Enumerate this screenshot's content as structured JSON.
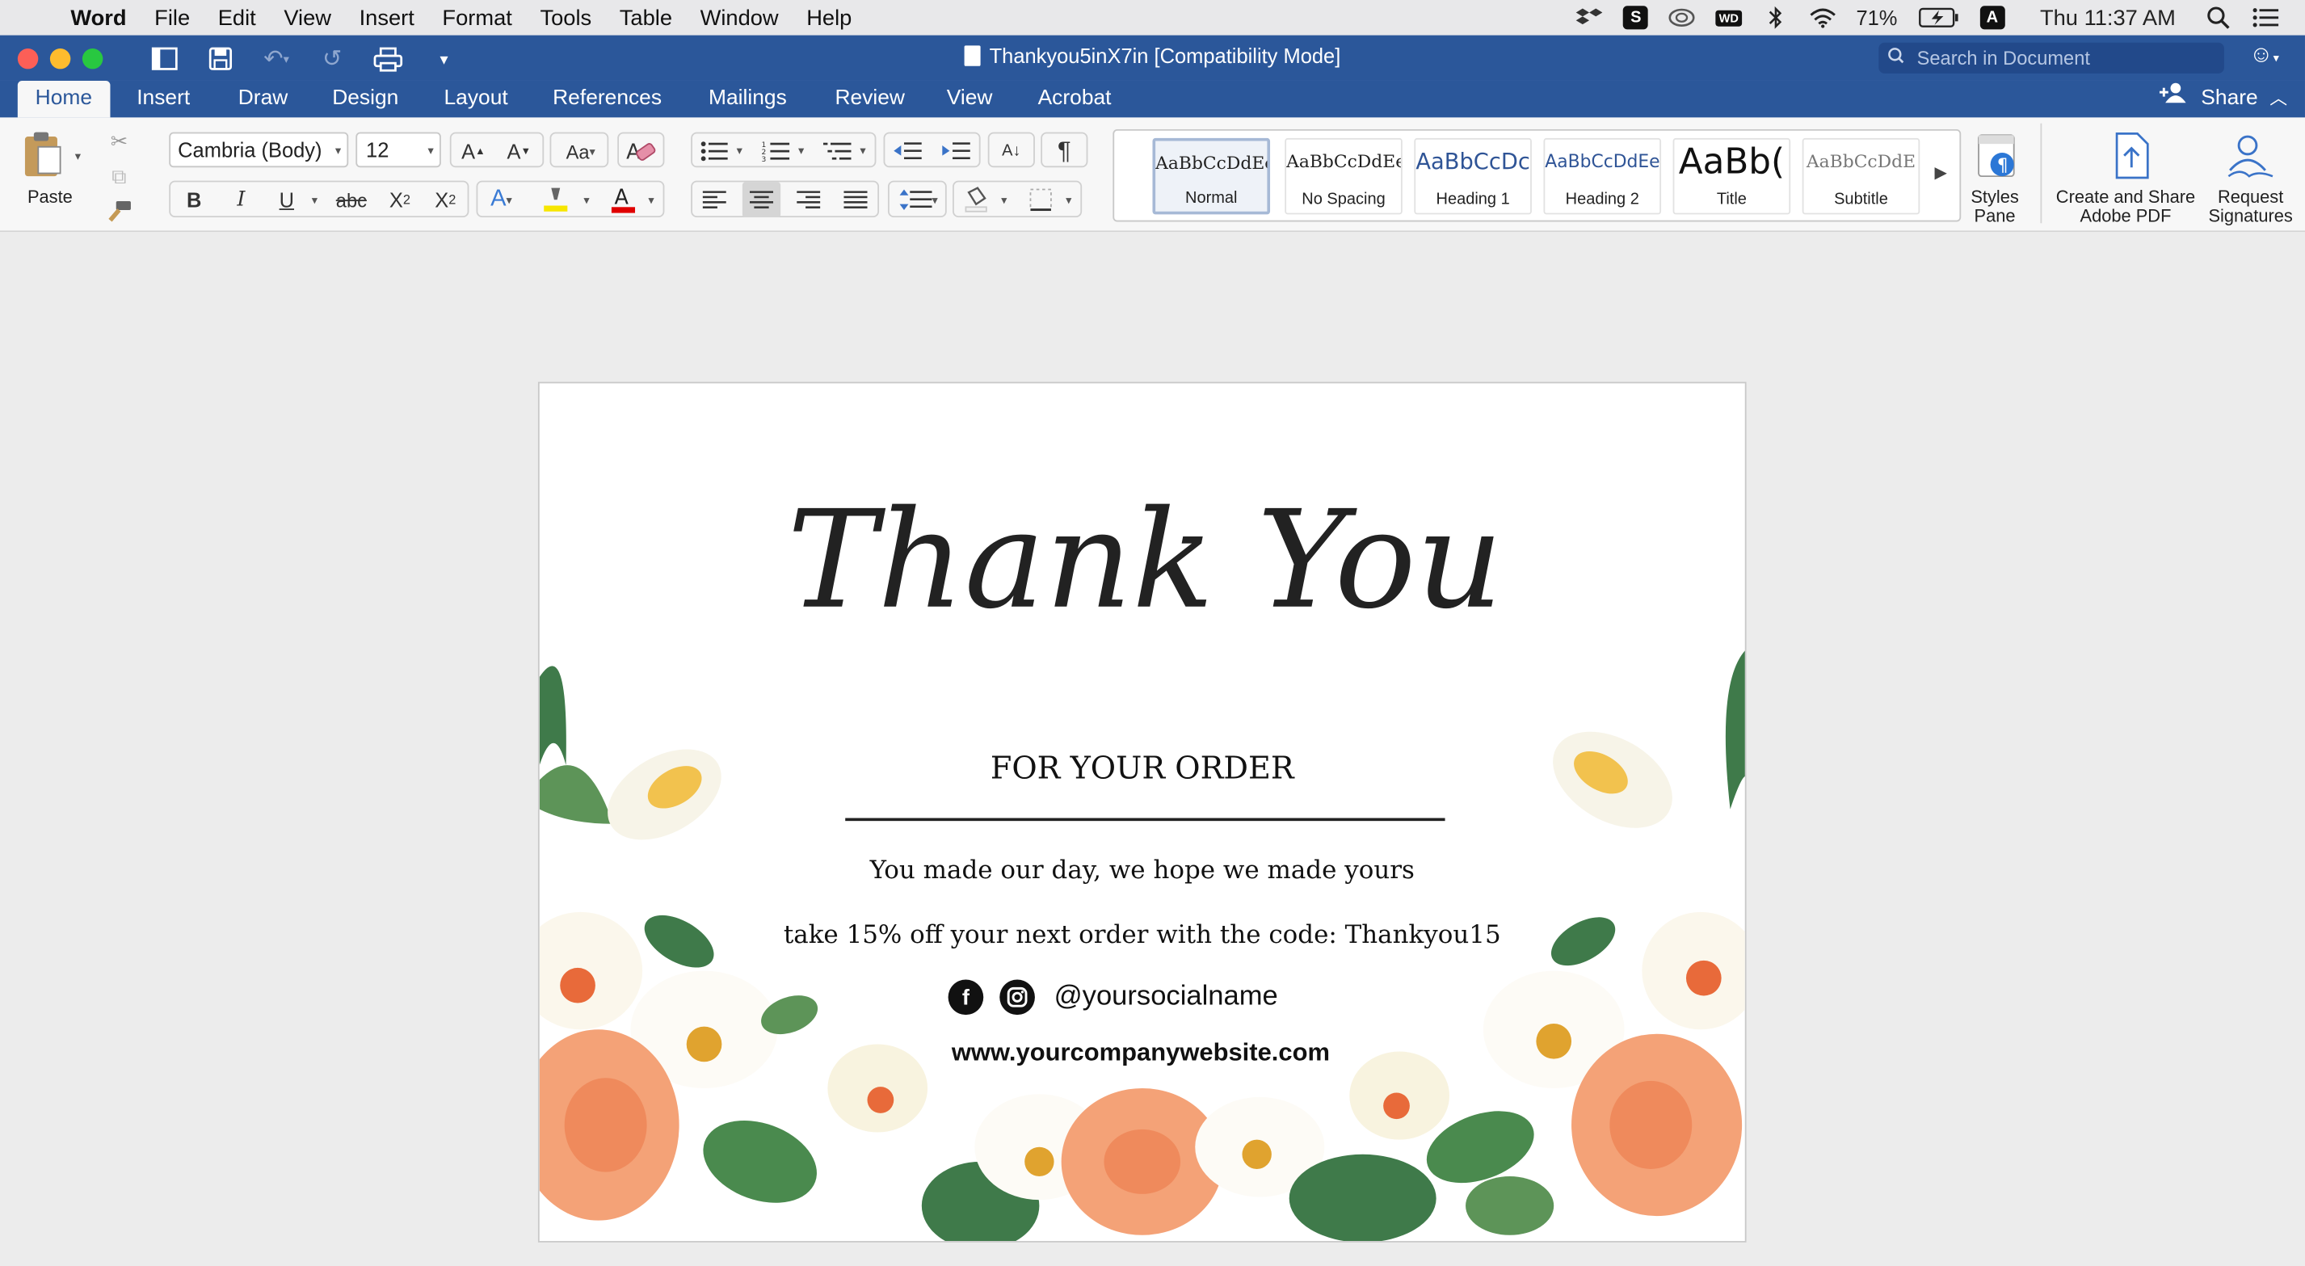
{
  "menubar": {
    "app": "Word",
    "items": [
      "File",
      "Edit",
      "View",
      "Insert",
      "Format",
      "Tools",
      "Table",
      "Window",
      "Help"
    ],
    "battery": "71%",
    "input_source": "A",
    "clock": "Thu 11:37 AM"
  },
  "window": {
    "title": "Thankyou5inX7in [Compatibility Mode]",
    "search_placeholder": "Search in Document"
  },
  "ribbon_tabs": [
    "Home",
    "Insert",
    "Draw",
    "Design",
    "Layout",
    "References",
    "Mailings",
    "Review",
    "View",
    "Acrobat"
  ],
  "active_tab": "Home",
  "share_label": "Share",
  "ribbon": {
    "paste_label": "Paste",
    "font_name": "Cambria (Body)",
    "font_size": "12",
    "styles": [
      {
        "preview": "AaBbCcDdEe",
        "name": "Normal"
      },
      {
        "preview": "AaBbCcDdEe",
        "name": "No Spacing"
      },
      {
        "preview": "AaBbCcDc",
        "name": "Heading 1"
      },
      {
        "preview": "AaBbCcDdEe",
        "name": "Heading 2"
      },
      {
        "preview": "AaBb(",
        "name": "Title"
      },
      {
        "preview": "AaBbCcDdE",
        "name": "Subtitle"
      }
    ],
    "styles_pane_label": "Styles Pane",
    "create_share_pdf_label": "Create and Share Adobe PDF",
    "request_signatures_label": "Request Signatures"
  },
  "colors": {
    "word_blue": "#2b579a",
    "highlight_yellow": "#f7e600",
    "font_red": "#e00000",
    "flower_peach": "#f4a277",
    "leaf_green": "#3f7a4a"
  },
  "document": {
    "headline": "Thank You",
    "subheading": "FOR YOUR ORDER",
    "line1": "You made our day, we hope we made yours",
    "line2": "take 15% off your next order with the code: Thankyou15",
    "social_handle": "@yoursocialname",
    "website": "www.yourcompanywebsite.com"
  }
}
